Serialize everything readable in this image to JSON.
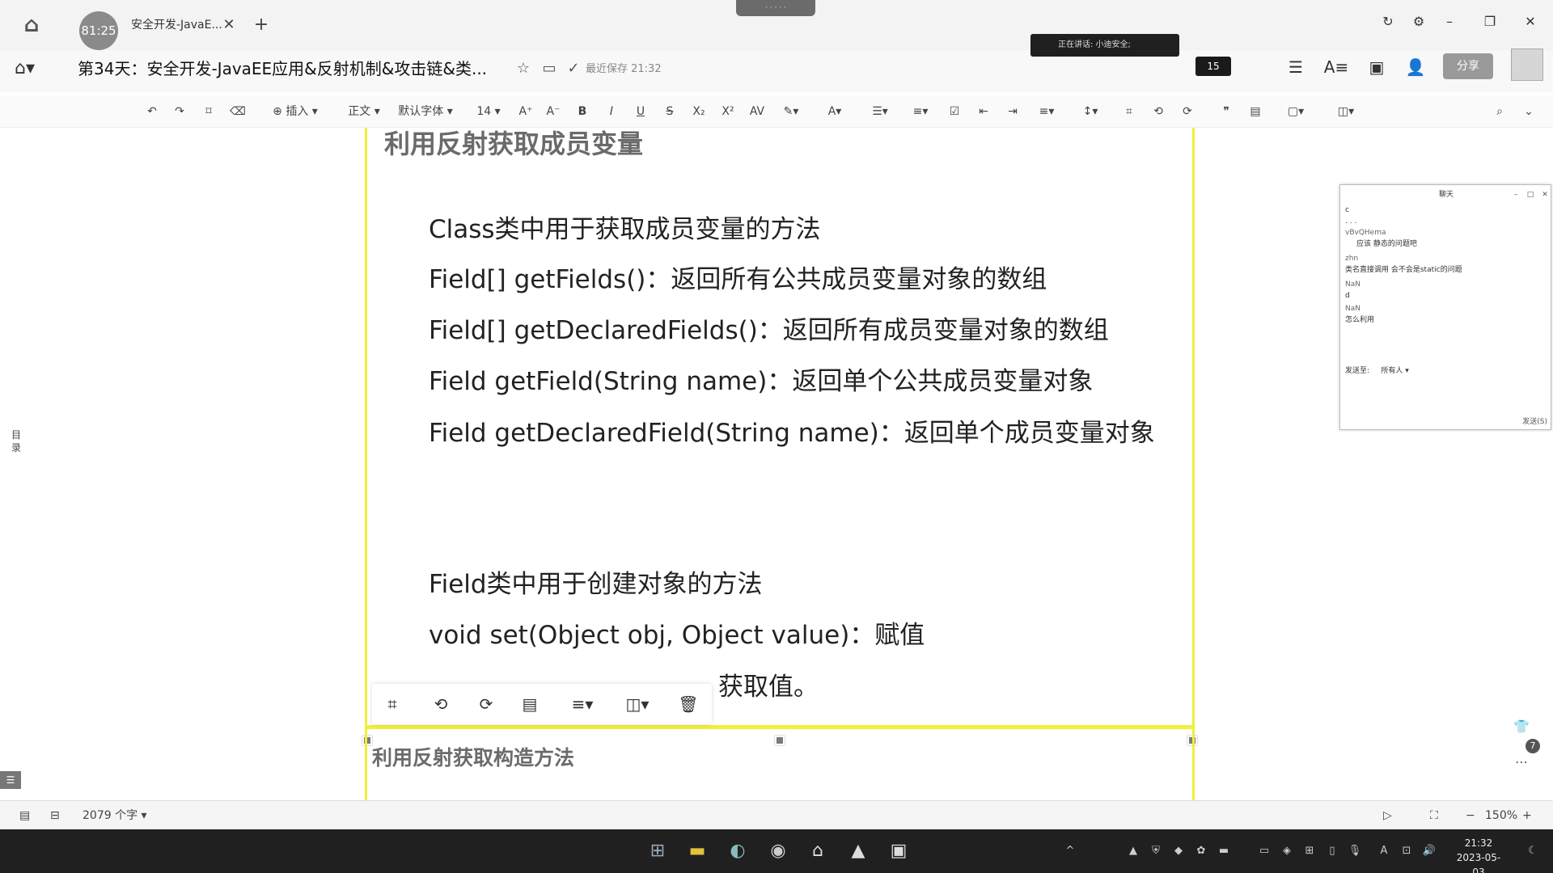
{
  "titlebar": {
    "recording_time": "81:25",
    "tab_label": "安全开发-JavaE...",
    "tab_close": "✕",
    "tab_add": "+",
    "indicator": "· · · · ·"
  },
  "document": {
    "title": "第34天：安全开发-JavaEE应用&反射机制&攻击链&类...",
    "save_status": "最近保存 21:32",
    "speaker_text": "正在讲话: 小迪安全;",
    "participant_count": "15",
    "share_label": "分享"
  },
  "toolbar": {
    "insert": "插入",
    "style": "正文",
    "font": "默认字体",
    "size": "14"
  },
  "slide": {
    "heading": "利用反射获取成员变量",
    "lines": [
      "Class类中用于获取成员变量的方法",
      "Field[] getFields()：返回所有公共成员变量对象的数组",
      "Field[] getDeclaredFields()：返回所有成员变量对象的数组",
      "Field getField(String name)：返回单个公共成员变量对象",
      "Field getDeclaredField(String name)：返回单个成员变量对象",
      "Field类中用于创建对象的方法",
      "void set(Object obj, Object value)：赋值",
      "获取值。"
    ],
    "next_heading": "利用反射获取构造方法"
  },
  "sidebar": {
    "toc_label": "目录"
  },
  "chat": {
    "title": "聊天",
    "messages": [
      {
        "text": "c"
      },
      {
        "text": ". . ."
      },
      {
        "text": "vBvQHema",
        "name": true
      },
      {
        "text": "应该 静态的问题吧"
      },
      {
        "text": "zhn",
        "name": true
      },
      {
        "text": "类名直接调用   会不会是static的问题"
      },
      {
        "text": "NaN",
        "name": true
      },
      {
        "text": "d"
      },
      {
        "text": "NaN",
        "name": true
      },
      {
        "text": "怎么利用"
      }
    ],
    "send_to_label": "发送至:",
    "recipient": "所有人",
    "send_button": "发送(S)"
  },
  "statusbar": {
    "word_count": "2079 个字",
    "zoom": "150%",
    "minus": "−",
    "plus": "+"
  },
  "taskbar": {
    "time": "21:32",
    "date": "2023-05-03",
    "badge": "7"
  }
}
